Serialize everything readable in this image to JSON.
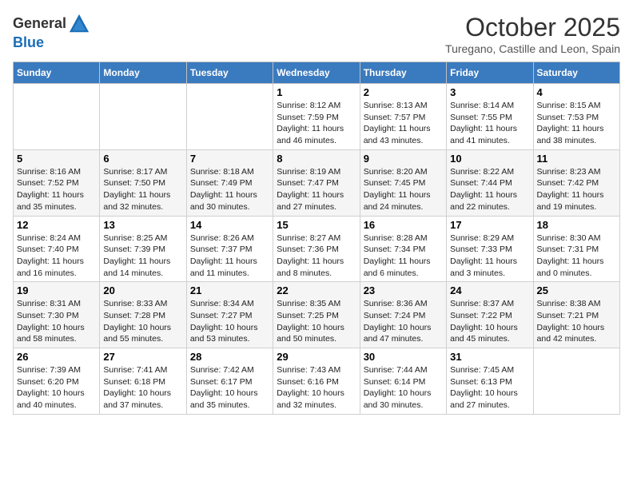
{
  "header": {
    "logo_line1": "General",
    "logo_line2": "Blue",
    "month": "October 2025",
    "location": "Turegano, Castille and Leon, Spain"
  },
  "weekdays": [
    "Sunday",
    "Monday",
    "Tuesday",
    "Wednesday",
    "Thursday",
    "Friday",
    "Saturday"
  ],
  "weeks": [
    [
      {
        "day": "",
        "info": ""
      },
      {
        "day": "",
        "info": ""
      },
      {
        "day": "",
        "info": ""
      },
      {
        "day": "1",
        "info": "Sunrise: 8:12 AM\nSunset: 7:59 PM\nDaylight: 11 hours\nand 46 minutes."
      },
      {
        "day": "2",
        "info": "Sunrise: 8:13 AM\nSunset: 7:57 PM\nDaylight: 11 hours\nand 43 minutes."
      },
      {
        "day": "3",
        "info": "Sunrise: 8:14 AM\nSunset: 7:55 PM\nDaylight: 11 hours\nand 41 minutes."
      },
      {
        "day": "4",
        "info": "Sunrise: 8:15 AM\nSunset: 7:53 PM\nDaylight: 11 hours\nand 38 minutes."
      }
    ],
    [
      {
        "day": "5",
        "info": "Sunrise: 8:16 AM\nSunset: 7:52 PM\nDaylight: 11 hours\nand 35 minutes."
      },
      {
        "day": "6",
        "info": "Sunrise: 8:17 AM\nSunset: 7:50 PM\nDaylight: 11 hours\nand 32 minutes."
      },
      {
        "day": "7",
        "info": "Sunrise: 8:18 AM\nSunset: 7:49 PM\nDaylight: 11 hours\nand 30 minutes."
      },
      {
        "day": "8",
        "info": "Sunrise: 8:19 AM\nSunset: 7:47 PM\nDaylight: 11 hours\nand 27 minutes."
      },
      {
        "day": "9",
        "info": "Sunrise: 8:20 AM\nSunset: 7:45 PM\nDaylight: 11 hours\nand 24 minutes."
      },
      {
        "day": "10",
        "info": "Sunrise: 8:22 AM\nSunset: 7:44 PM\nDaylight: 11 hours\nand 22 minutes."
      },
      {
        "day": "11",
        "info": "Sunrise: 8:23 AM\nSunset: 7:42 PM\nDaylight: 11 hours\nand 19 minutes."
      }
    ],
    [
      {
        "day": "12",
        "info": "Sunrise: 8:24 AM\nSunset: 7:40 PM\nDaylight: 11 hours\nand 16 minutes."
      },
      {
        "day": "13",
        "info": "Sunrise: 8:25 AM\nSunset: 7:39 PM\nDaylight: 11 hours\nand 14 minutes."
      },
      {
        "day": "14",
        "info": "Sunrise: 8:26 AM\nSunset: 7:37 PM\nDaylight: 11 hours\nand 11 minutes."
      },
      {
        "day": "15",
        "info": "Sunrise: 8:27 AM\nSunset: 7:36 PM\nDaylight: 11 hours\nand 8 minutes."
      },
      {
        "day": "16",
        "info": "Sunrise: 8:28 AM\nSunset: 7:34 PM\nDaylight: 11 hours\nand 6 minutes."
      },
      {
        "day": "17",
        "info": "Sunrise: 8:29 AM\nSunset: 7:33 PM\nDaylight: 11 hours\nand 3 minutes."
      },
      {
        "day": "18",
        "info": "Sunrise: 8:30 AM\nSunset: 7:31 PM\nDaylight: 11 hours\nand 0 minutes."
      }
    ],
    [
      {
        "day": "19",
        "info": "Sunrise: 8:31 AM\nSunset: 7:30 PM\nDaylight: 10 hours\nand 58 minutes."
      },
      {
        "day": "20",
        "info": "Sunrise: 8:33 AM\nSunset: 7:28 PM\nDaylight: 10 hours\nand 55 minutes."
      },
      {
        "day": "21",
        "info": "Sunrise: 8:34 AM\nSunset: 7:27 PM\nDaylight: 10 hours\nand 53 minutes."
      },
      {
        "day": "22",
        "info": "Sunrise: 8:35 AM\nSunset: 7:25 PM\nDaylight: 10 hours\nand 50 minutes."
      },
      {
        "day": "23",
        "info": "Sunrise: 8:36 AM\nSunset: 7:24 PM\nDaylight: 10 hours\nand 47 minutes."
      },
      {
        "day": "24",
        "info": "Sunrise: 8:37 AM\nSunset: 7:22 PM\nDaylight: 10 hours\nand 45 minutes."
      },
      {
        "day": "25",
        "info": "Sunrise: 8:38 AM\nSunset: 7:21 PM\nDaylight: 10 hours\nand 42 minutes."
      }
    ],
    [
      {
        "day": "26",
        "info": "Sunrise: 7:39 AM\nSunset: 6:20 PM\nDaylight: 10 hours\nand 40 minutes."
      },
      {
        "day": "27",
        "info": "Sunrise: 7:41 AM\nSunset: 6:18 PM\nDaylight: 10 hours\nand 37 minutes."
      },
      {
        "day": "28",
        "info": "Sunrise: 7:42 AM\nSunset: 6:17 PM\nDaylight: 10 hours\nand 35 minutes."
      },
      {
        "day": "29",
        "info": "Sunrise: 7:43 AM\nSunset: 6:16 PM\nDaylight: 10 hours\nand 32 minutes."
      },
      {
        "day": "30",
        "info": "Sunrise: 7:44 AM\nSunset: 6:14 PM\nDaylight: 10 hours\nand 30 minutes."
      },
      {
        "day": "31",
        "info": "Sunrise: 7:45 AM\nSunset: 6:13 PM\nDaylight: 10 hours\nand 27 minutes."
      },
      {
        "day": "",
        "info": ""
      }
    ]
  ]
}
